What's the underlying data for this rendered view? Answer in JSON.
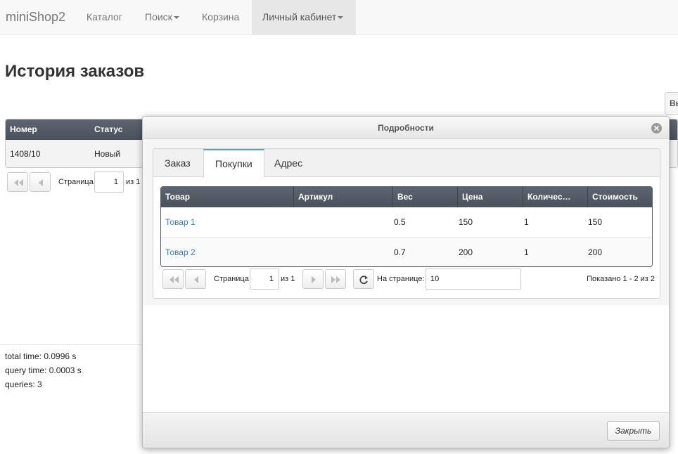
{
  "navbar": {
    "brand": "miniShop2",
    "items": [
      {
        "label": "Каталог"
      },
      {
        "label": "Поиск"
      },
      {
        "label": "Корзина"
      },
      {
        "label": "Личный кабинет"
      }
    ]
  },
  "page": {
    "title": "История заказов",
    "side_button": "Вь"
  },
  "orders_grid": {
    "columns": [
      "Номер",
      "Статус"
    ],
    "rows": [
      {
        "number": "1408/10",
        "status": "Новый"
      }
    ],
    "pager": {
      "page_label": "Страница",
      "page_value": "1",
      "of_label": "из 1"
    }
  },
  "debug": {
    "total_time": "total time: 0.0996 s",
    "query_time": "query time: 0.0003 s",
    "queries": "queries: 3"
  },
  "modal": {
    "title": "Подробности",
    "tabs": [
      {
        "label": "Заказ"
      },
      {
        "label": "Покупки"
      },
      {
        "label": "Адрес"
      }
    ],
    "products_grid": {
      "columns": [
        "Товар",
        "Артикул",
        "Вес",
        "Цена",
        "Количес…",
        "Стоимость"
      ],
      "rows": [
        {
          "name": "Товар 1",
          "article": "",
          "weight": "0.5",
          "price": "150",
          "count": "1",
          "cost": "150"
        },
        {
          "name": "Товар 2",
          "article": "",
          "weight": "0.7",
          "price": "200",
          "count": "1",
          "cost": "200"
        }
      ],
      "pager": {
        "page_label": "Страница",
        "page_value": "1",
        "of_label": "из 1",
        "per_page_label": "На странице:",
        "per_page_value": "10",
        "shown": "Показано 1 - 2 из 2"
      }
    },
    "close_label": "Закрыть"
  }
}
